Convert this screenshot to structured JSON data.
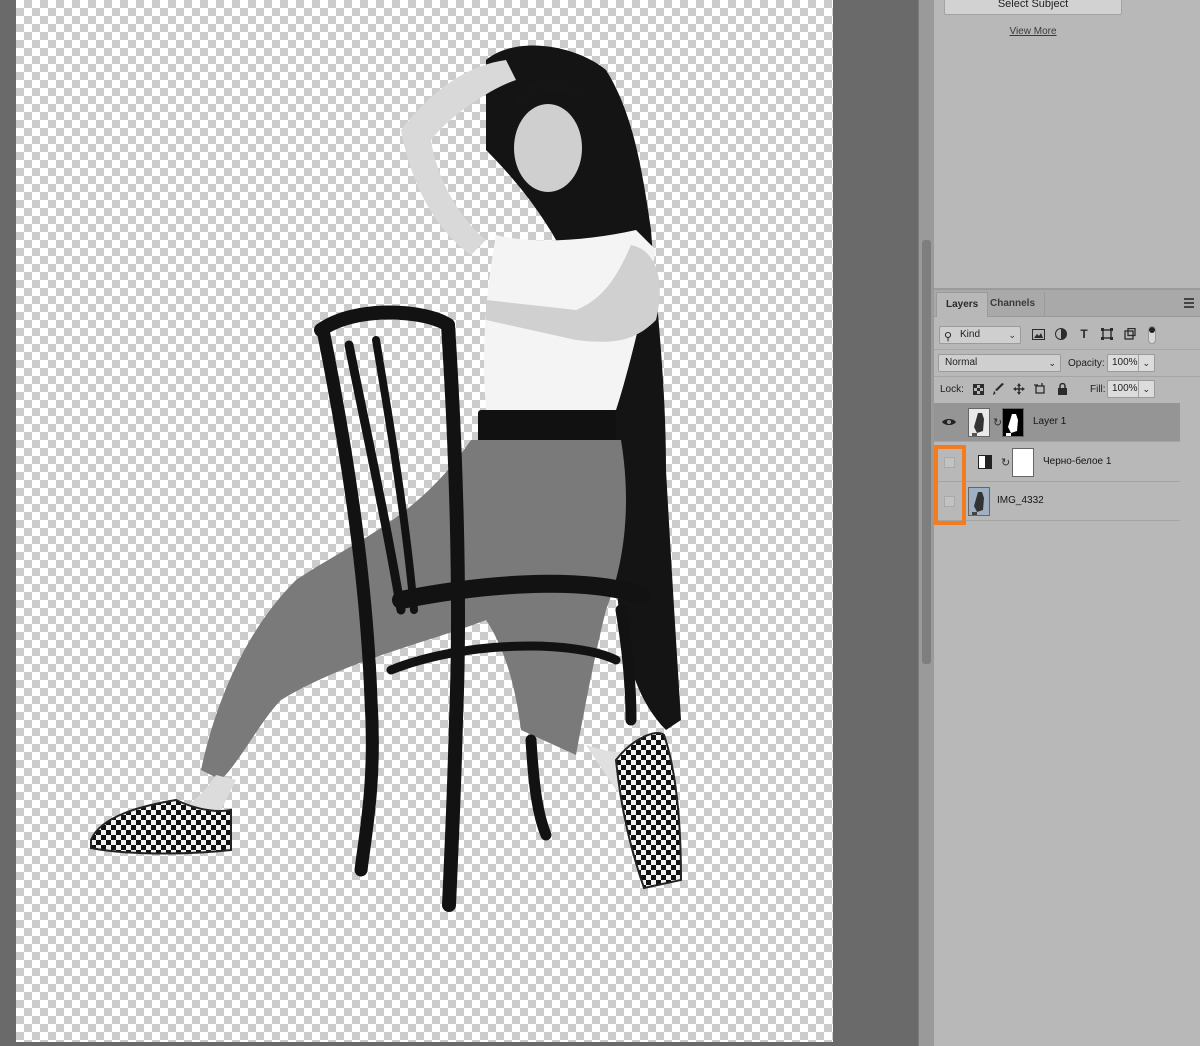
{
  "properties_panel": {
    "select_subject_label": "Select Subject",
    "view_more_label": "View More"
  },
  "layers_panel": {
    "tabs": [
      {
        "label": "Layers",
        "active": true
      },
      {
        "label": "Channels",
        "active": false
      }
    ],
    "filter": {
      "kind_label": "Kind",
      "filter_icons": [
        "image-filter-icon",
        "adjustment-filter-icon",
        "type-filter-icon",
        "shape-filter-icon",
        "smart-object-filter-icon"
      ],
      "type_icon_glyph": "T"
    },
    "blend_mode": "Normal",
    "opacity_label": "Opacity:",
    "opacity_value": "100%",
    "lock_label": "Lock:",
    "lock_icons": [
      "lock-transparent-icon",
      "lock-paint-icon",
      "lock-position-icon",
      "lock-artboard-icon",
      "lock-all-icon"
    ],
    "fill_label": "Fill:",
    "fill_value": "100%",
    "layers": [
      {
        "name": "Layer 1",
        "visible": true,
        "selected": true,
        "has_mask": true
      },
      {
        "name": "Черно-белое 1",
        "visible": false,
        "selected": false,
        "adjustment": true
      },
      {
        "name": "IMG_4332",
        "visible": false,
        "selected": false,
        "has_mask": false
      }
    ]
  },
  "colors": {
    "highlight": "#f47c20",
    "panel_bg": "#b8b8b8",
    "workspace_bg": "#6a6a6a"
  }
}
